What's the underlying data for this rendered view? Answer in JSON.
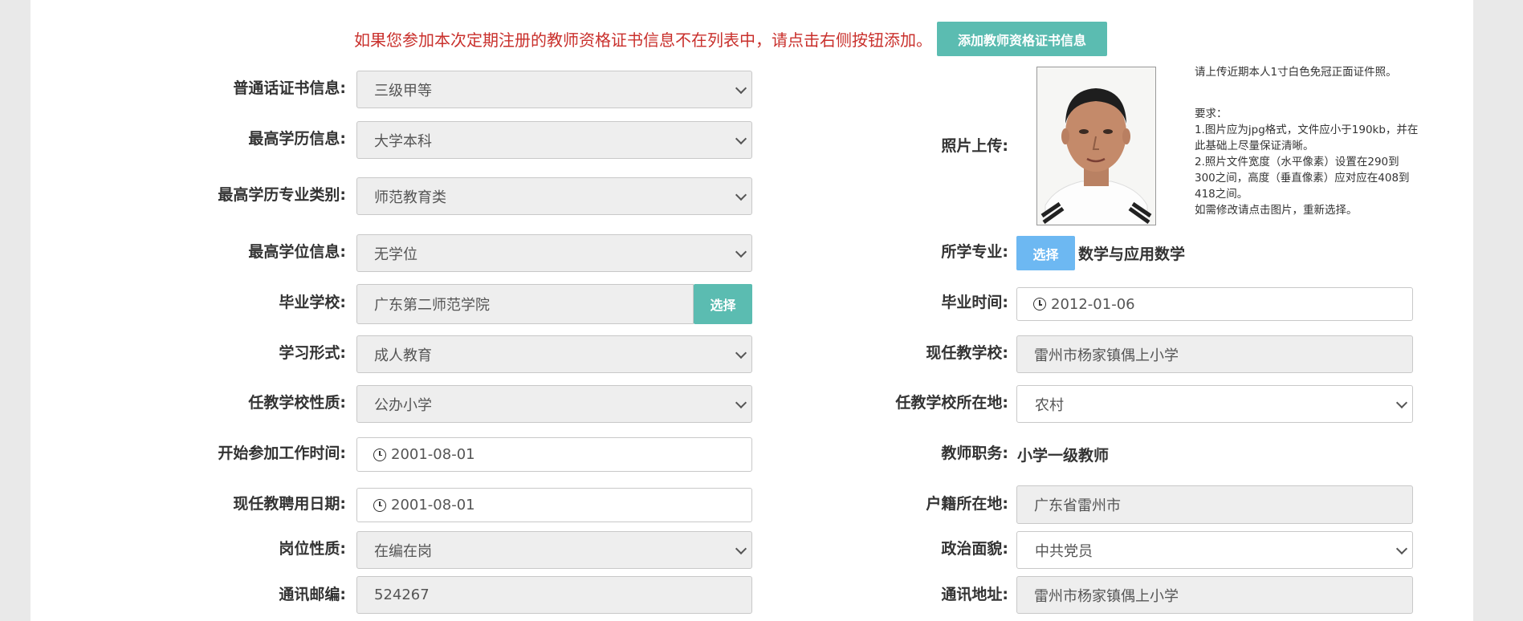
{
  "notice": "如果您参加本次定期注册的教师资格证书信息不在列表中，请点击右侧按钮添加。",
  "add_button": "添加教师资格证书信息",
  "left_fields": {
    "mandarin": {
      "label": "普通话证书信息:",
      "value": "三级甲等"
    },
    "education": {
      "label": "最高学历信息:",
      "value": "大学本科"
    },
    "major_category": {
      "label": "最高学历专业类别:",
      "value": "师范教育类"
    },
    "degree": {
      "label": "最高学位信息:",
      "value": "无学位"
    },
    "school": {
      "label": "毕业学校:",
      "value": "广东第二师范学院",
      "button": "选择"
    },
    "study_form": {
      "label": "学习形式:",
      "value": "成人教育"
    },
    "school_nature": {
      "label": "任教学校性质:",
      "value": "公办小学"
    },
    "work_start": {
      "label": "开始参加工作时间:",
      "value": "2001-08-01"
    },
    "hire_date": {
      "label": "现任教聘用日期:",
      "value": "2001-08-01"
    },
    "post_nature": {
      "label": "岗位性质:",
      "value": "在编在岗"
    },
    "postcode": {
      "label": "通讯邮编:",
      "value": "524267"
    }
  },
  "right_fields": {
    "photo": {
      "label": "照片上传:",
      "hint_main": "请上传近期本人1寸白色免冠正面证件照。",
      "hint_title": "要求：",
      "hint_lines": [
        "1.图片应为jpg格式，文件应小于190kb，并在此基础上尽量保证清晰。",
        "2.照片文件宽度（水平像素）设置在290到300之间，高度（垂直像素）应对应在408到418之间。",
        "如需修改请点击图片，重新选择。"
      ]
    },
    "major": {
      "label": "所学专业:",
      "button": "选择",
      "value": "数学与应用数学"
    },
    "grad_time": {
      "label": "毕业时间:",
      "value": "2012-01-06"
    },
    "current_school": {
      "label": "现任教学校:",
      "value": "雷州市杨家镇偶上小学"
    },
    "school_location": {
      "label": "任教学校所在地:",
      "value": "农村"
    },
    "title": {
      "label": "教师职务:",
      "value": "小学一级教师"
    },
    "household": {
      "label": "户籍所在地:",
      "value": "广东省雷州市"
    },
    "political": {
      "label": "政治面貌:",
      "value": "中共党员"
    },
    "address": {
      "label": "通讯地址:",
      "value": "雷州市杨家镇偶上小学"
    }
  }
}
